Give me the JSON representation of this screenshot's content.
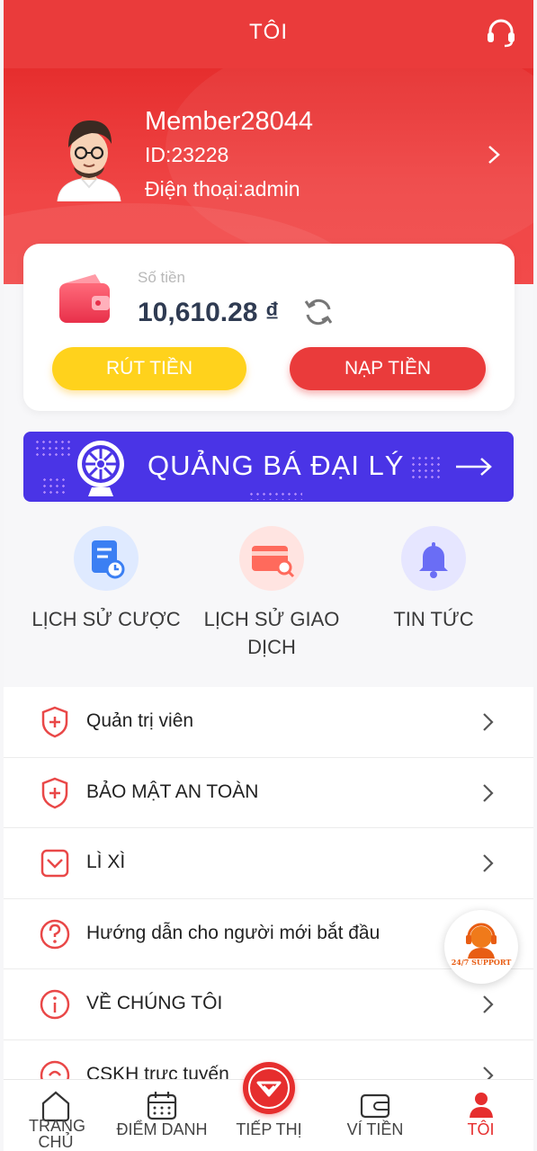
{
  "header": {
    "title": "TÔI",
    "support_icon": "headset-icon"
  },
  "profile": {
    "name": "Member28044",
    "id_text": "ID:23228",
    "phone_text": "Điện thoại:admin"
  },
  "balance": {
    "label": "Số tiền",
    "value": "10,610.28 ₫",
    "withdraw_label": "RÚT TIỀN",
    "deposit_label": "NẠP TIỀN"
  },
  "banner": {
    "text": "QUẢNG BÁ ĐẠI LÝ"
  },
  "quick_actions": [
    {
      "label": "LỊCH SỬ CƯỢC",
      "icon": "bet-history-icon"
    },
    {
      "label": "LỊCH SỬ GIAO DỊCH",
      "icon": "transaction-history-icon"
    },
    {
      "label": "TIN TỨC",
      "icon": "bell-icon"
    }
  ],
  "menu": [
    {
      "label": "Quản trị viên",
      "icon": "shield-plus-icon"
    },
    {
      "label": "BẢO MẬT AN TOÀN",
      "icon": "shield-plus-icon"
    },
    {
      "label": "LÌ XÌ",
      "icon": "envelope-icon"
    },
    {
      "label": "Hướng dẫn cho người mới bắt đầu",
      "icon": "question-icon"
    },
    {
      "label": "VỀ CHÚNG TÔI",
      "icon": "info-icon"
    },
    {
      "label": "CSKH trực tuyến",
      "icon": "support-icon"
    }
  ],
  "float_support": {
    "text": "24/7 SUPPORT"
  },
  "bottom_nav": [
    {
      "label": "TRANG CHỦ",
      "icon": "home-icon"
    },
    {
      "label": "ĐIỂM DANH",
      "icon": "calendar-icon"
    },
    {
      "label": "TIẾP THỊ",
      "icon": "marketing-icon"
    },
    {
      "label": "VÍ TIỀN",
      "icon": "wallet-icon"
    },
    {
      "label": "TÔI",
      "icon": "user-icon",
      "active": true
    }
  ],
  "colors": {
    "primary_red": "#ea3b3b",
    "yellow": "#ffd21c",
    "banner_purple": "#4a34e6"
  }
}
